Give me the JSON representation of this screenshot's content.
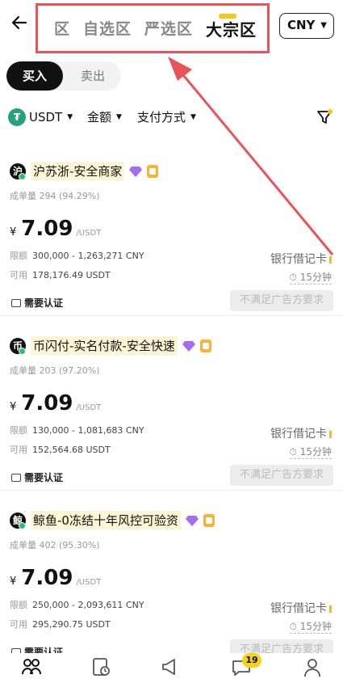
{
  "header": {
    "zones": [
      {
        "label": "区",
        "partial": true
      },
      {
        "label": "自选区"
      },
      {
        "label": "严选区"
      },
      {
        "label": "大宗区",
        "active": true
      }
    ],
    "currency": "CNY"
  },
  "trade_toggle": {
    "buy": "买入",
    "sell": "卖出"
  },
  "filters": {
    "coin": "USDT",
    "amount": "金额",
    "payment": "支付方式"
  },
  "ads": [
    {
      "avatar_char": "沪",
      "merchant": "沪苏浙-安全商家",
      "stats_label": "成单量",
      "stats": "294 (94.29%)",
      "currency_symbol": "¥",
      "price": "7.09",
      "unit": "/USDT",
      "limit_label": "限额",
      "limit": "300,000 - 1,263,271 CNY",
      "avail_label": "可用",
      "available": "178,176.49 USDT",
      "payment": "银行借记卡",
      "time": "15分钟",
      "verify": "需要认证",
      "action": "不满足广告方要求"
    },
    {
      "avatar_char": "币",
      "merchant": "币闪付-实名付款-安全快速",
      "stats_label": "成单量",
      "stats": "203 (97.20%)",
      "currency_symbol": "¥",
      "price": "7.09",
      "unit": "/USDT",
      "limit_label": "限额",
      "limit": "130,000 - 1,081,683 CNY",
      "avail_label": "可用",
      "available": "152,564.68 USDT",
      "payment": "银行借记卡",
      "time": "15分钟",
      "verify": "需要认证",
      "action": "不满足广告方要求"
    },
    {
      "avatar_char": "鲸",
      "merchant": "鲸鱼-0冻结十年风控可验资",
      "stats_label": "成单量",
      "stats": "402 (95.30%)",
      "currency_symbol": "¥",
      "price": "7.09",
      "unit": "/USDT",
      "limit_label": "限额",
      "limit": "250,000 - 2,093,611 CNY",
      "avail_label": "可用",
      "available": "295,290.75 USDT",
      "payment": "银行借记卡",
      "time": "15分钟",
      "verify": "需要认证",
      "action": "不满足广告方要求"
    }
  ],
  "bottom_nav": {
    "items": [
      "p2p-icon",
      "orders-icon",
      "ads-icon",
      "chat-icon",
      "profile-icon"
    ],
    "chat_badge": "19"
  },
  "colors": {
    "highlight_box": "#e8545a",
    "accent_yellow": "#f5c518",
    "usdt_green": "#26a17b"
  }
}
